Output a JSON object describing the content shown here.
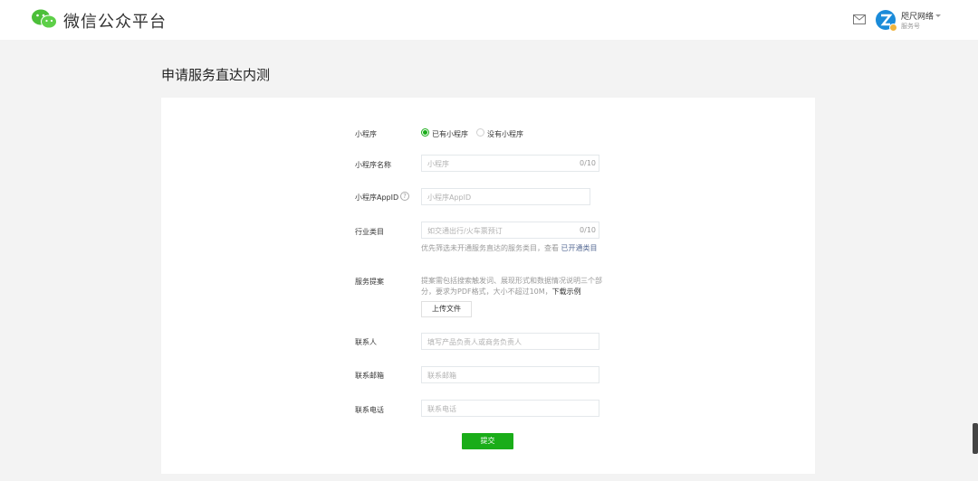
{
  "header": {
    "app_title": "微信公众平台",
    "account_name": "咫尺网络",
    "account_type": "服务号"
  },
  "page": {
    "title": "申请服务直达内测"
  },
  "form": {
    "miniprogram_label": "小程序",
    "radio_has": "已有小程序",
    "radio_none": "没有小程序",
    "name_label": "小程序名称",
    "name_placeholder": "小程序",
    "name_count": "0/10",
    "appid_label": "小程序AppID",
    "appid_help": "?",
    "appid_placeholder": "小程序AppID",
    "industry_label": "行业类目",
    "industry_placeholder": "如交通出行/火车票预订",
    "industry_count": "0/10",
    "industry_hint": "优先筛选未开通服务直达的服务类目，查看 ",
    "industry_hint_link": "已开通类目",
    "proposal_label": "服务提案",
    "proposal_hint_1": "提案需包括搜索触发词、展现形式和数据情况说明三个部",
    "proposal_hint_2": "分，要求为PDF格式，大小不超过10M，",
    "proposal_hint_link": "下载示例",
    "upload_label": "上传文件",
    "contact_label": "联系人",
    "contact_placeholder": "填写产品负责人或商务负责人",
    "email_label": "联系邮箱",
    "email_placeholder": "联系邮箱",
    "phone_label": "联系电话",
    "phone_placeholder": "联系电话",
    "submit_label": "提交"
  },
  "colors": {
    "accent": "#1aad19",
    "link": "#576b95"
  }
}
